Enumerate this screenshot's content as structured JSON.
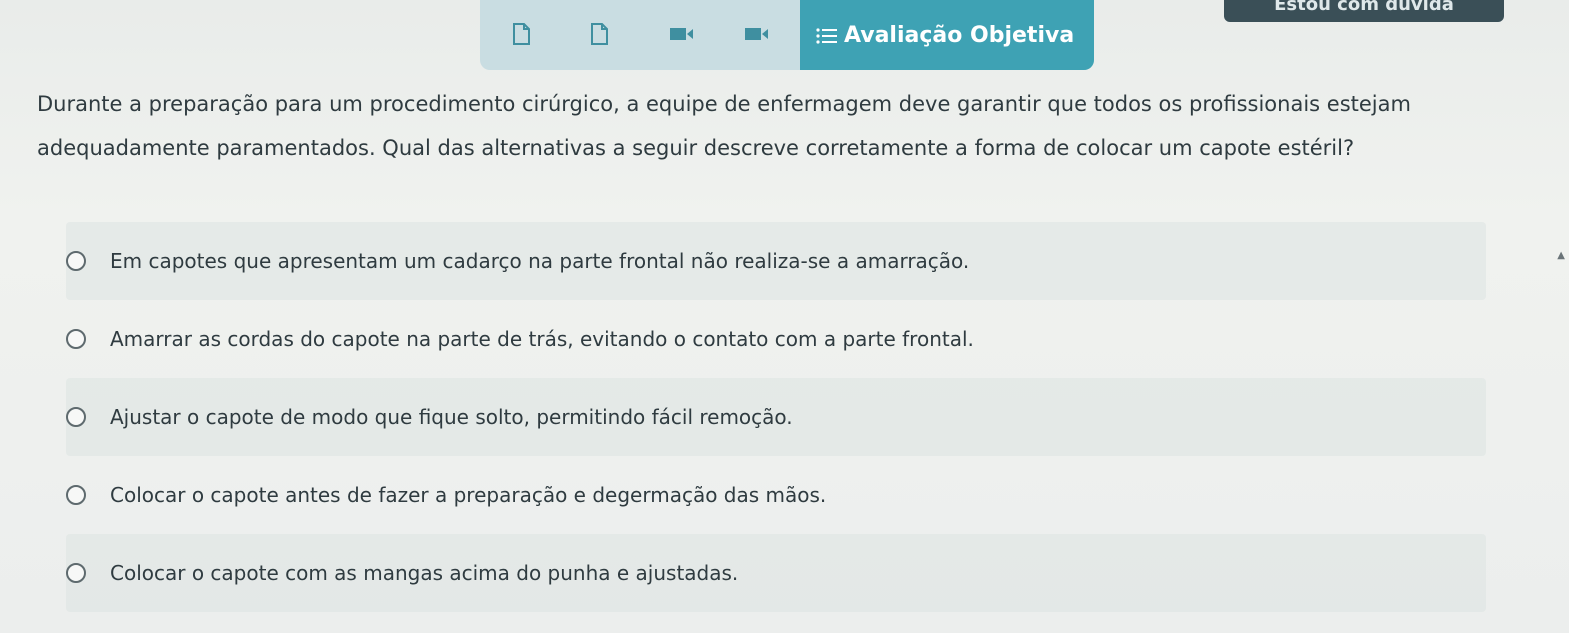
{
  "toolbar": {
    "icons": [
      "document-icon",
      "document-icon",
      "video-icon",
      "video-icon"
    ],
    "active_tab_label": "Avaliação Objetiva",
    "active_tab_icon": "list-icon"
  },
  "help_button_label": "Estou com dúvida",
  "question": {
    "text": "Durante a preparação para um procedimento cirúrgico, a equipe de enfermagem deve garantir que todos os profissionais estejam adequadamente paramentados. Qual das alternativas a seguir descreve corretamente a forma de colocar um capote estéril?"
  },
  "options": [
    "Em capotes que apresentam um cadarço na parte frontal não realiza-se a amarração.",
    "Amarrar as cordas do capote na parte de trás, evitando o contato com a parte frontal.",
    "Ajustar o capote de modo que fique solto, permitindo fácil remoção.",
    "Colocar o capote antes de fazer a preparação e degermação das mãos.",
    "Colocar o capote com as mangas acima do punha e ajustadas."
  ],
  "colors": {
    "accent": "#3ea2b4",
    "toolbar_bg": "#c9dde2",
    "help_bg": "#3a4f57"
  }
}
